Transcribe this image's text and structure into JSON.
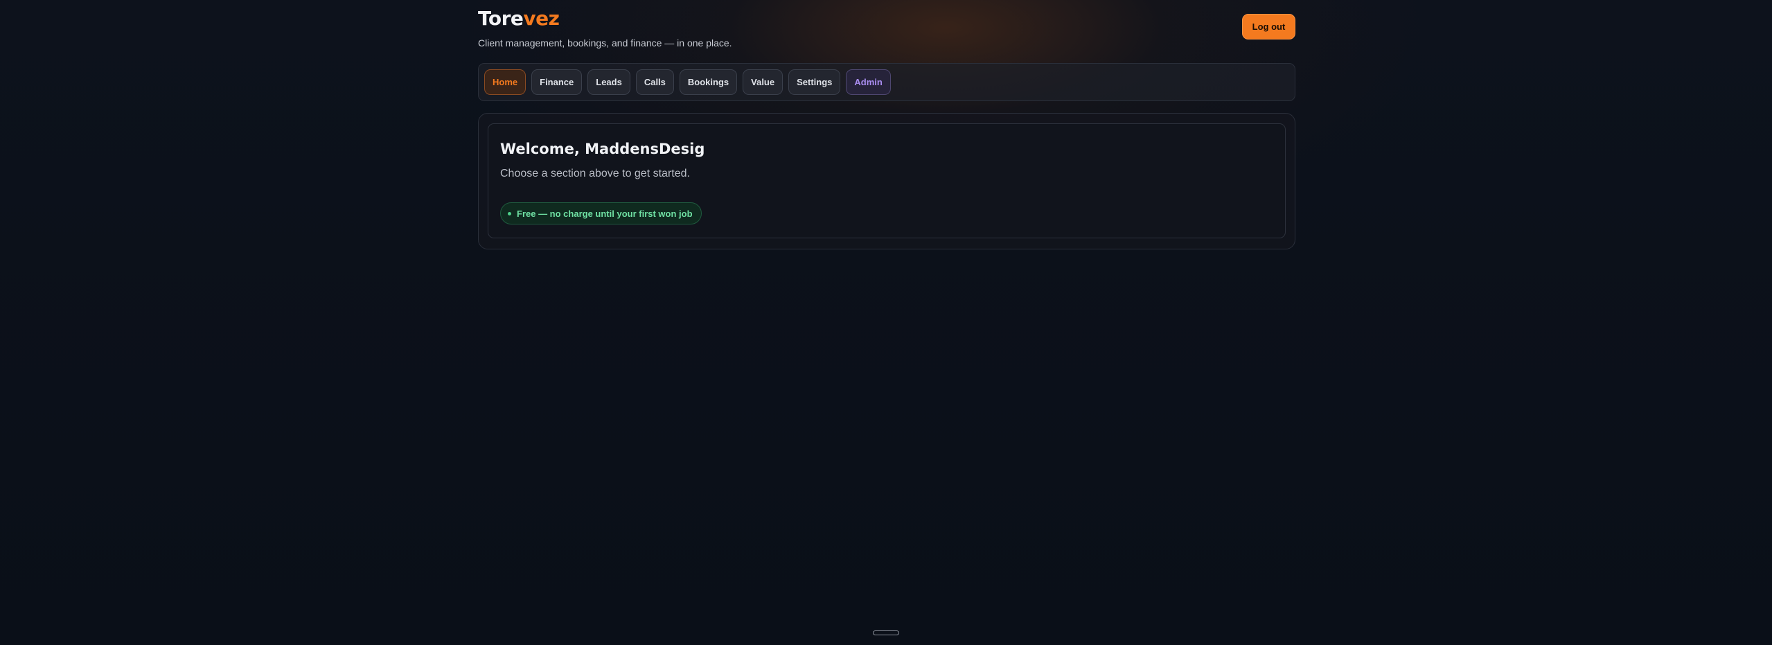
{
  "app": {
    "brand_part1": "Tore",
    "brand_part2": "vez",
    "tagline": "Client management, bookings, and finance — in one place.",
    "logout_label": "Log out"
  },
  "nav": {
    "tabs": [
      {
        "label": "Home",
        "active": true
      },
      {
        "label": "Finance"
      },
      {
        "label": "Leads"
      },
      {
        "label": "Calls"
      },
      {
        "label": "Bookings"
      },
      {
        "label": "Value"
      },
      {
        "label": "Settings"
      },
      {
        "label": "Admin"
      }
    ]
  },
  "home": {
    "welcome": "Welcome, MaddensDesig",
    "subtitle": "Choose a section above to get started.",
    "badge": "Free — no charge until your first won job"
  },
  "colors": {
    "accent": "#f47a1f",
    "admin": "#a98df0",
    "success": "#6fe0a3",
    "background": "#0b1019"
  },
  "icons": {
    "badge_dot": "status-dot-icon"
  }
}
